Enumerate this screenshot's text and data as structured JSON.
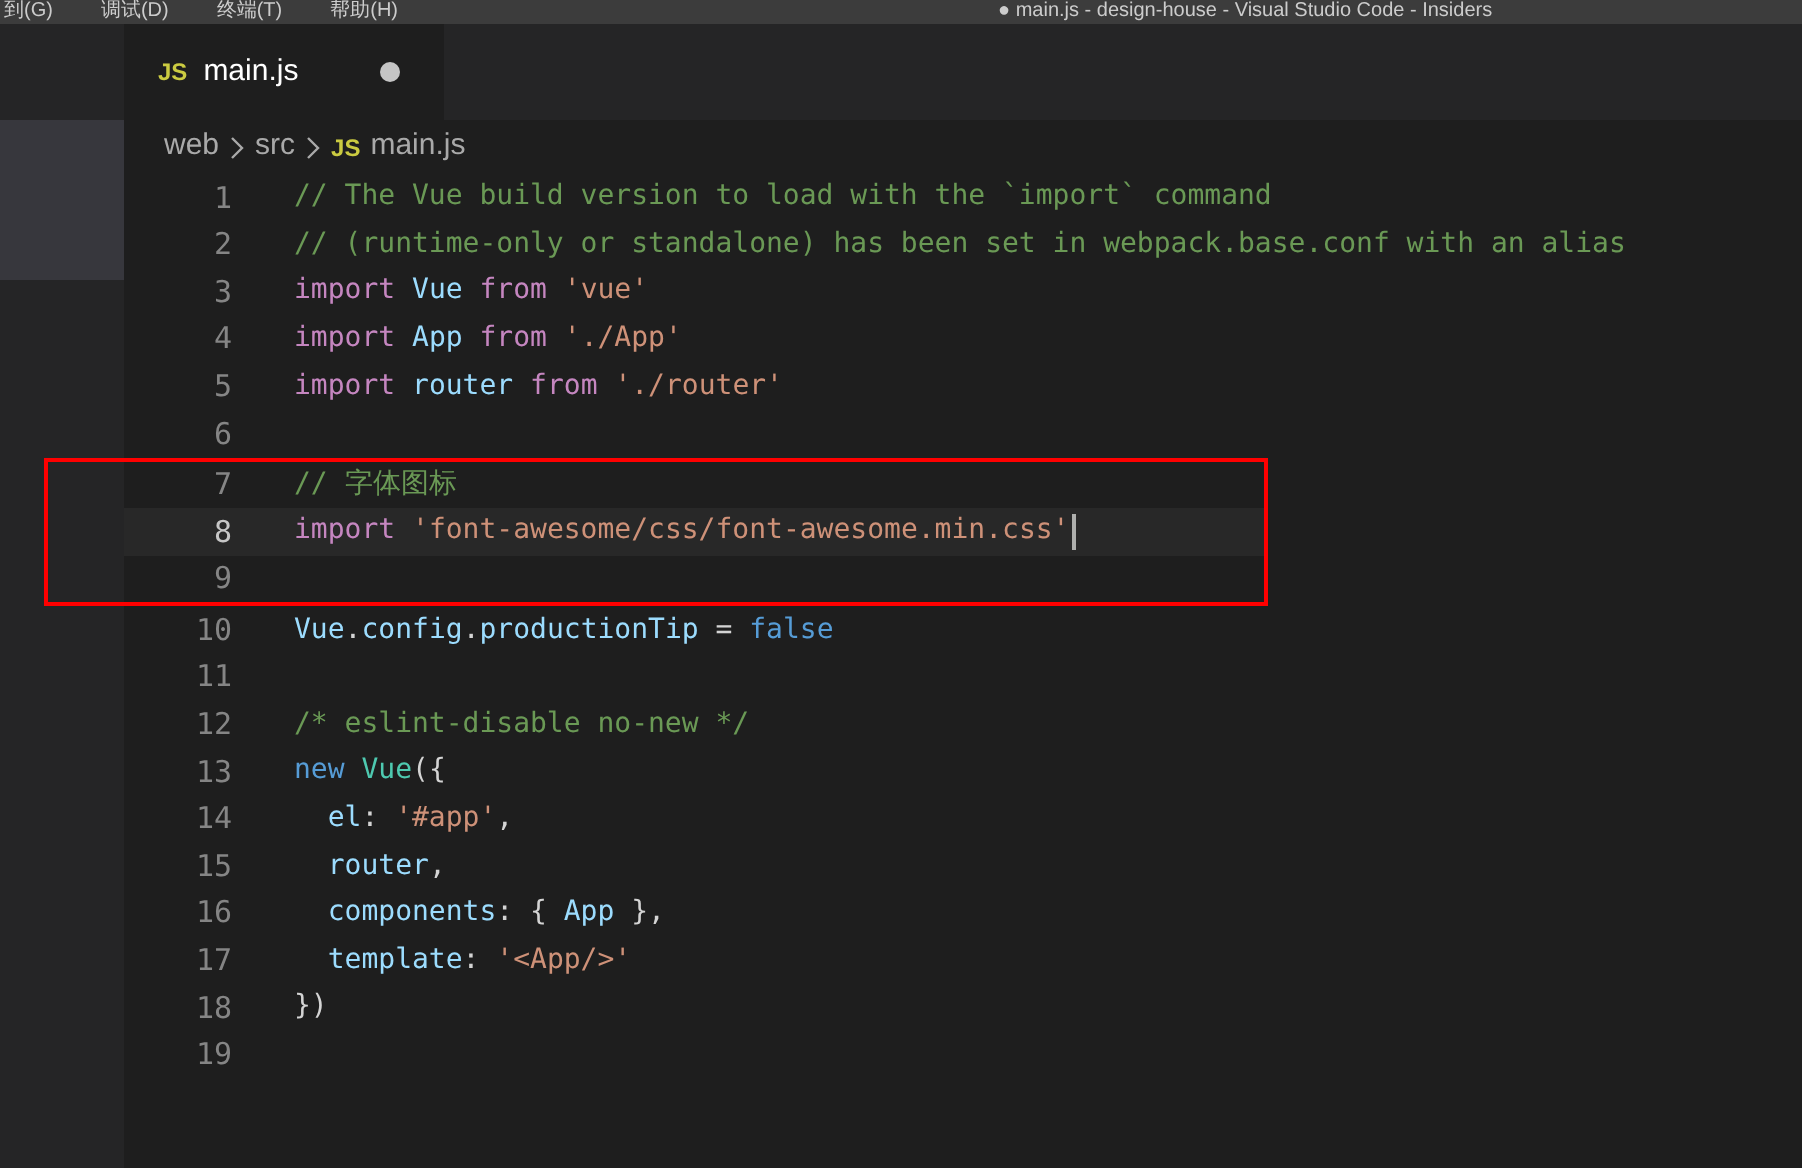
{
  "menu_bar": {
    "items": [
      "到(G)",
      "调试(D)",
      "终端(T)",
      "帮助(H)"
    ],
    "title": "● main.js - design-house - Visual Studio Code - Insiders"
  },
  "tabs": [
    {
      "badge": "JS",
      "label": "main.js",
      "modified": true,
      "selected": true
    }
  ],
  "breadcrumb": [
    {
      "label": "web"
    },
    {
      "label": "src"
    },
    {
      "badge": "JS",
      "label": "main.js"
    }
  ],
  "editor": {
    "lines": [
      {
        "number": "1",
        "current": false,
        "boxed": false,
        "tokens": [
          {
            "kind": "comment",
            "text": "// The Vue build version to load with the `import` command"
          }
        ]
      },
      {
        "number": "2",
        "current": false,
        "boxed": false,
        "tokens": [
          {
            "kind": "comment",
            "text": "// (runtime-only or standalone) has been set in webpack.base.conf with an alias"
          }
        ]
      },
      {
        "number": "3",
        "current": false,
        "boxed": false,
        "tokens": [
          {
            "kind": "keyword",
            "text": "import "
          },
          {
            "kind": "variable",
            "text": "Vue "
          },
          {
            "kind": "keyword",
            "text": "from "
          },
          {
            "kind": "string",
            "text": "'vue'"
          }
        ]
      },
      {
        "number": "4",
        "current": false,
        "boxed": false,
        "tokens": [
          {
            "kind": "keyword",
            "text": "import "
          },
          {
            "kind": "variable",
            "text": "App "
          },
          {
            "kind": "keyword",
            "text": "from "
          },
          {
            "kind": "string",
            "text": "'./App'"
          }
        ]
      },
      {
        "number": "5",
        "current": false,
        "boxed": false,
        "tokens": [
          {
            "kind": "keyword",
            "text": "import "
          },
          {
            "kind": "variable",
            "text": "router "
          },
          {
            "kind": "keyword",
            "text": "from "
          },
          {
            "kind": "string",
            "text": "'./router'"
          }
        ]
      },
      {
        "number": "6",
        "current": false,
        "boxed": false
      },
      {
        "number": "7",
        "current": false,
        "boxed": true,
        "tokens": [
          {
            "kind": "comment",
            "text": "// 字体图标"
          }
        ]
      },
      {
        "number": "8",
        "current": true,
        "boxed": true,
        "tokens": [
          {
            "kind": "keyword",
            "text": "import "
          },
          {
            "kind": "string",
            "text": "'font-awesome/css/font-awesome.min.css'"
          }
        ]
      },
      {
        "number": "9",
        "current": false,
        "boxed": true
      },
      {
        "number": "10",
        "current": false,
        "boxed": false,
        "tokens": [
          {
            "kind": "variable",
            "text": "Vue"
          },
          {
            "kind": "plain",
            "text": "."
          },
          {
            "kind": "variable",
            "text": "config"
          },
          {
            "kind": "plain",
            "text": "."
          },
          {
            "kind": "variable",
            "text": "productionTip"
          },
          {
            "kind": "plain",
            "text": " = "
          },
          {
            "kind": "constant",
            "text": "false"
          }
        ]
      },
      {
        "number": "11",
        "current": false,
        "boxed": false
      },
      {
        "number": "12",
        "current": false,
        "boxed": false,
        "tokens": [
          {
            "kind": "comment",
            "text": "/* eslint-disable no-new */"
          }
        ]
      },
      {
        "number": "13",
        "current": false,
        "boxed": false,
        "tokens": [
          {
            "kind": "constant",
            "text": "new "
          },
          {
            "kind": "class",
            "text": "Vue"
          },
          {
            "kind": "plain",
            "text": "({"
          }
        ]
      },
      {
        "number": "14",
        "current": false,
        "boxed": false,
        "tokens": [
          {
            "kind": "variable",
            "text": "  el"
          },
          {
            "kind": "plain",
            "text": ": "
          },
          {
            "kind": "string",
            "text": "'#app'"
          },
          {
            "kind": "plain",
            "text": ","
          }
        ]
      },
      {
        "number": "15",
        "current": false,
        "boxed": false,
        "tokens": [
          {
            "kind": "variable",
            "text": "  router"
          },
          {
            "kind": "plain",
            "text": ","
          }
        ]
      },
      {
        "number": "16",
        "current": false,
        "boxed": false,
        "tokens": [
          {
            "kind": "variable",
            "text": "  components"
          },
          {
            "kind": "plain",
            "text": ": { "
          },
          {
            "kind": "variable",
            "text": "App"
          },
          {
            "kind": "plain",
            "text": " },"
          }
        ]
      },
      {
        "number": "17",
        "current": false,
        "boxed": false,
        "tokens": [
          {
            "kind": "variable",
            "text": "  template"
          },
          {
            "kind": "plain",
            "text": ": "
          },
          {
            "kind": "string",
            "text": "'<App/>'"
          }
        ]
      },
      {
        "number": "18",
        "current": false,
        "boxed": false,
        "tokens": [
          {
            "kind": "plain",
            "text": "})"
          }
        ]
      },
      {
        "number": "19",
        "current": false,
        "boxed": false
      }
    ]
  }
}
